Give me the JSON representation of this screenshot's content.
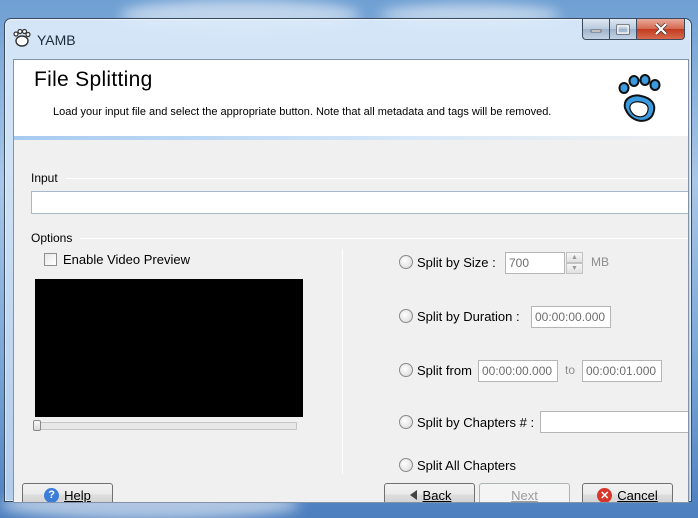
{
  "window": {
    "title": "YAMB"
  },
  "header": {
    "title": "File Splitting",
    "description": "Load your input file and select the appropriate button. Note that all metadata and tags will be removed."
  },
  "input": {
    "group_label": "Input",
    "value": ""
  },
  "options": {
    "group_label": "Options",
    "enable_video_preview_label": "Enable Video Preview",
    "enable_video_preview_checked": false,
    "split_by_size": {
      "label": "Split by Size :",
      "value": "700",
      "unit": "MB"
    },
    "split_by_duration": {
      "label": "Split by Duration :",
      "value": "00:00:00.000"
    },
    "split_from": {
      "label": "Split from",
      "from": "00:00:00.000",
      "to_label": "to",
      "to": "00:00:01.000"
    },
    "split_by_chapters": {
      "label": "Split by Chapters # :",
      "value": ""
    },
    "split_all_chapters": {
      "label": "Split All Chapters"
    }
  },
  "buttons": {
    "help": "Help",
    "back": "Back",
    "next": "Next",
    "cancel": "Cancel"
  },
  "colors": {
    "header_accent": "#a6caf0",
    "help_icon": "#3b7dd8",
    "cancel_icon": "#d9362b"
  }
}
